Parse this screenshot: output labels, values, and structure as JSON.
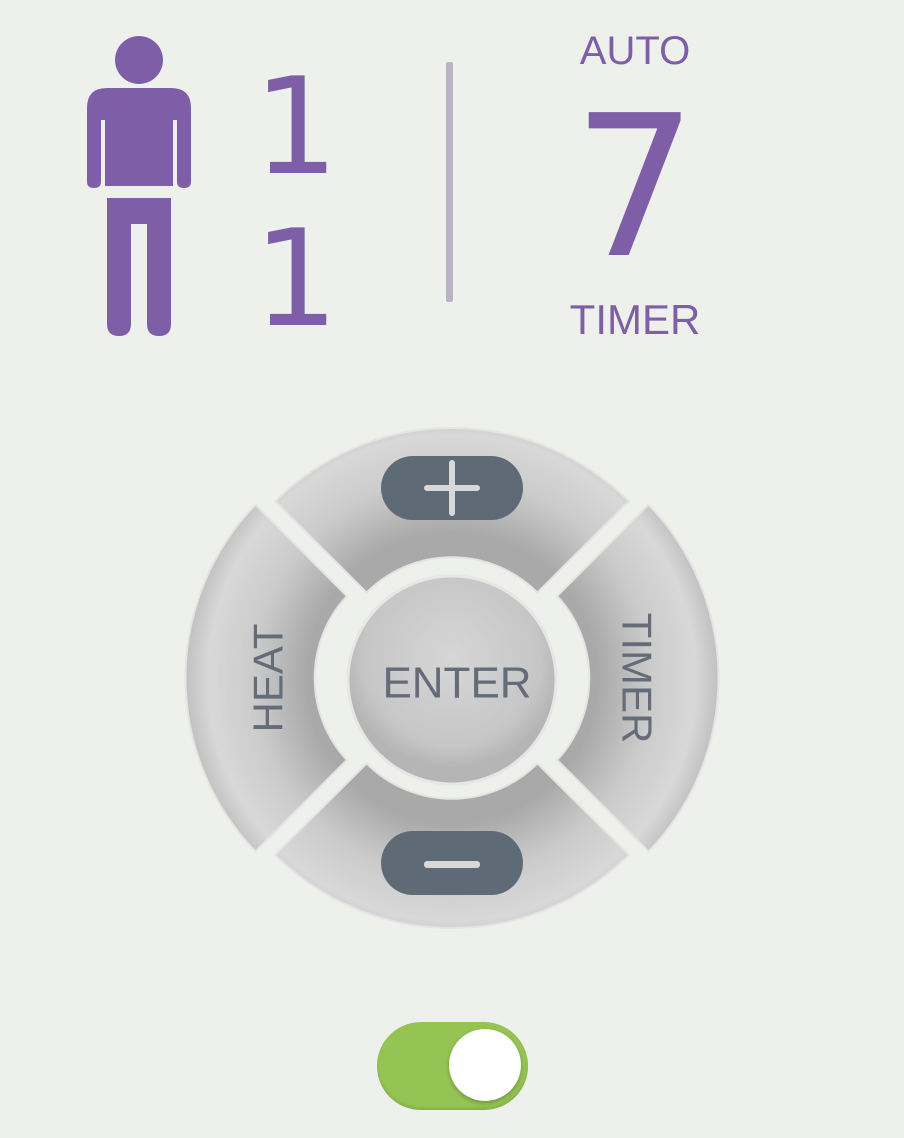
{
  "occupancy": {
    "icon": "person-icon",
    "value_top": "1",
    "value_bottom": "1"
  },
  "status": {
    "mode_label": "AUTO",
    "timer_value": "7",
    "timer_label": "TIMER"
  },
  "dpad": {
    "up_icon": "plus-icon",
    "down_icon": "minus-icon",
    "left_label": "HEAT",
    "right_label": "TIMER",
    "center_label": "ENTER"
  },
  "power_toggle": {
    "state": "on",
    "accent_color": "#95c454"
  },
  "colors": {
    "accent": "#7e5fa7",
    "background": "#eef0ec",
    "button_text": "#646c78",
    "icon_pill": "#5f6a77"
  }
}
